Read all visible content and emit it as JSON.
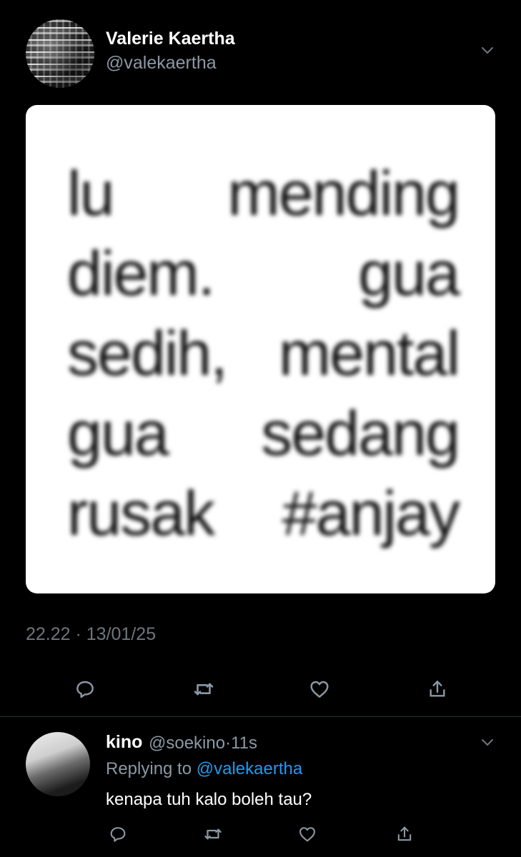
{
  "tweet": {
    "display_name": "Valerie Kaertha",
    "handle": "@valekaertha",
    "image_text_lines": [
      "lu mending",
      "diem. gua",
      "sedih, mental",
      "gua sedang",
      "rusak #anjay"
    ],
    "timestamp": "22.22 · 13/01/25"
  },
  "reply": {
    "display_name": "kino",
    "handle": "@soekino",
    "separator": "·",
    "age": "11s",
    "replying_to_prefix": "Replying to",
    "replying_to_handle": "@valekaertha",
    "text": "kenapa tuh kalo boleh tau?"
  },
  "icons": {
    "reply": "reply-icon",
    "retweet": "retweet-icon",
    "like": "heart-icon",
    "share": "share-icon",
    "more": "chevron-down-icon"
  },
  "colors": {
    "background": "#000000",
    "secondary_text": "#8b98a5",
    "link": "#1d9bf0",
    "icon": "#8b98a5"
  }
}
